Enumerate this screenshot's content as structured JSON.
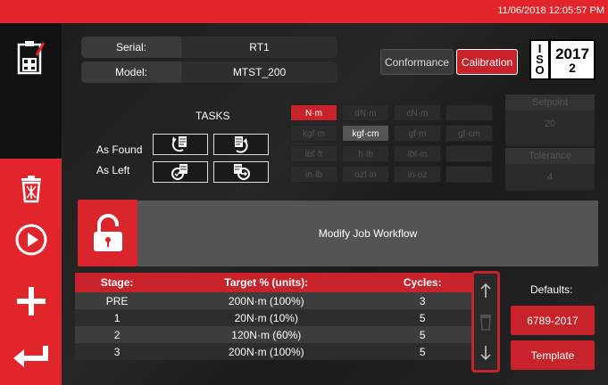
{
  "header": {
    "datetime": "11/06/2018 12:05:57 PM"
  },
  "device": {
    "serial_label": "Serial:",
    "serial_value": "RT1",
    "model_label": "Model:",
    "model_value": "MTST_200"
  },
  "mode": {
    "conformance": "Conformance",
    "calibration": "Calibration",
    "active": "Calibration"
  },
  "iso": {
    "left": [
      "I",
      "S",
      "O"
    ],
    "year": "2017",
    "number": "2"
  },
  "tasks": {
    "title": "TASKS",
    "as_found": "As Found",
    "as_left": "As Left"
  },
  "units": [
    [
      "N·m",
      "dN·m",
      "cN·m",
      ""
    ],
    [
      "kgf·m",
      "kgf·cm",
      "gf·m",
      "gf·cm"
    ],
    [
      "lbf·ft",
      "ft·lb",
      "lbf·in",
      ""
    ],
    [
      "in·lb",
      "ozf·in",
      "in·oz",
      ""
    ]
  ],
  "selected_units": [
    "N·m",
    "kgf·cm"
  ],
  "setpoint": {
    "label": "Setpoint",
    "value": "20"
  },
  "tolerance": {
    "label": "Tolerance",
    "value": "4"
  },
  "workflow": {
    "label": "Modify Job Workflow"
  },
  "stages_table": {
    "headers": [
      "Stage:",
      "Target % (units):",
      "Cycles:"
    ],
    "rows": [
      [
        "PRE",
        "200N·m (100%)",
        "3"
      ],
      [
        "1",
        "20N·m (10%)",
        "5"
      ],
      [
        "2",
        "120N·m (60%)",
        "5"
      ],
      [
        "3",
        "200N·m (100%)",
        "5"
      ]
    ]
  },
  "defaults": {
    "label": "Defaults:",
    "button1": "6789-2017",
    "button2": "Template"
  },
  "colors": {
    "accent": "#e1252b",
    "dark": "#1a1a1a"
  }
}
